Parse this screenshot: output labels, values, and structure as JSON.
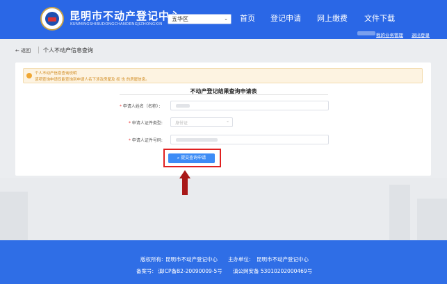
{
  "header": {
    "title": "昆明市不动产登记中心",
    "subtitle": "KUNMINGSHIBUDONGCHANDENGJIZHONGXIN",
    "district": "五华区",
    "nav": [
      "首页",
      "登记申请",
      "网上缴费",
      "文件下载"
    ],
    "my_business": "我的业务管理",
    "logout": "退出登录"
  },
  "breadcrumb": {
    "back": "← 返回",
    "title": "个人不动产信息查询"
  },
  "notice": {
    "line1": "个人不动产信息查询说明",
    "line2": "该项查询申请仅能查询到申请人名下涉及房屋及 权 也 的房屋信息。"
  },
  "form": {
    "title": "不动产登记结果查询申请表",
    "name_label": "申请人姓名（名称）：",
    "id_type_label": "申请人证件类型:",
    "id_type_value": "身份证",
    "id_number_label": "申请人证件号码:",
    "submit": "提交查询申请"
  },
  "footer": {
    "copyright_label": "版权所有:",
    "copyright": "昆明市不动产登记中心",
    "host_label": "主办单位:",
    "host": "昆明市不动产登记中心",
    "icp_label": "备案号:",
    "icp": "滇ICP备B2-20090009-5号",
    "police": "滇公网安备 53010202000469号"
  }
}
